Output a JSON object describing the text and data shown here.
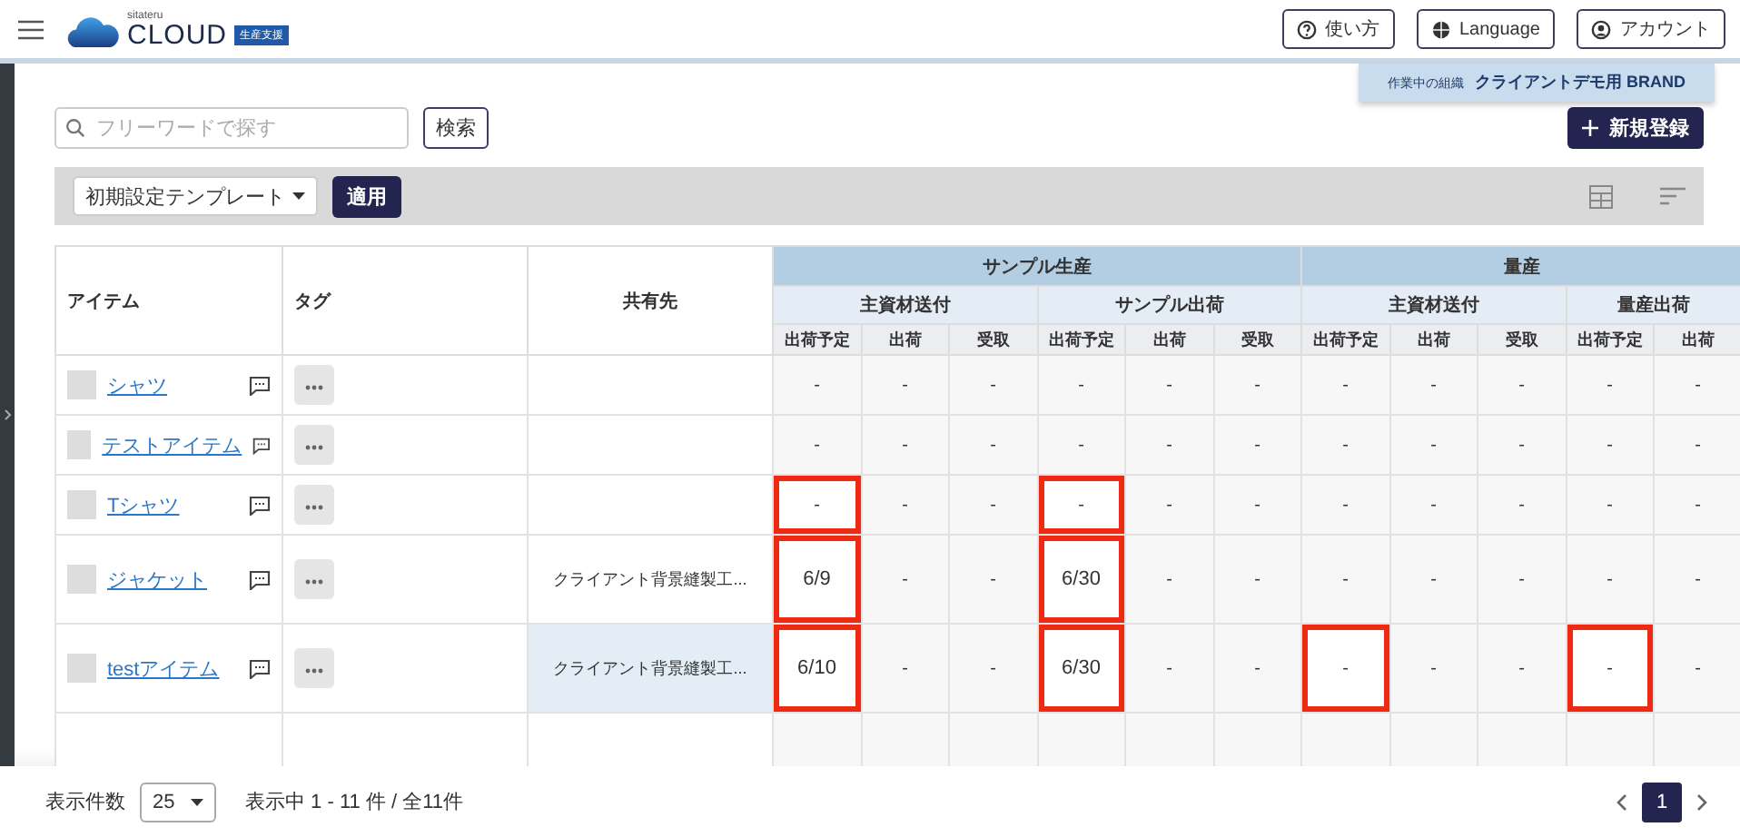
{
  "header": {
    "logo": {
      "tagline": "sitateru",
      "name": "CLOUD",
      "badge": "生産支援"
    },
    "buttons": [
      {
        "kind": "help",
        "label": "使い方"
      },
      {
        "kind": "globe",
        "label": "Language"
      },
      {
        "kind": "account",
        "label": "アカウント"
      }
    ]
  },
  "organization": {
    "label": "作業中の組織",
    "name": "クライアントデモ用 BRAND"
  },
  "search": {
    "placeholder": "フリーワードで探す",
    "button": "検索"
  },
  "new_button": "新規登録",
  "toolbar": {
    "template": "初期設定テンプレート",
    "apply": "適用"
  },
  "table": {
    "columns": [
      "アイテム",
      "タグ",
      "共有先"
    ],
    "groups": [
      {
        "label": "サンプル生産",
        "subgroups": [
          {
            "label": "主資材送付",
            "columns": [
              "出荷予定",
              "出荷",
              "受取"
            ]
          },
          {
            "label": "サンプル出荷",
            "columns": [
              "出荷予定",
              "出荷",
              "受取"
            ]
          }
        ]
      },
      {
        "label": "量産",
        "subgroups": [
          {
            "label": "主資材送付",
            "columns": [
              "出荷予定",
              "出荷",
              "受取"
            ]
          },
          {
            "label": "量産出荷",
            "columns": [
              "出荷予定",
              "出荷"
            ]
          }
        ]
      }
    ],
    "rows": [
      {
        "item": "シャツ",
        "shared": "",
        "hovered": false,
        "cells": [
          {
            "value": "-",
            "highlighted": false
          },
          {
            "value": "-",
            "highlighted": false
          },
          {
            "value": "-",
            "highlighted": false
          },
          {
            "value": "-",
            "highlighted": false
          },
          {
            "value": "-",
            "highlighted": false
          },
          {
            "value": "-",
            "highlighted": false
          },
          {
            "value": "-",
            "highlighted": false
          },
          {
            "value": "-",
            "highlighted": false
          },
          {
            "value": "-",
            "highlighted": false
          },
          {
            "value": "-",
            "highlighted": false
          },
          {
            "value": "-",
            "highlighted": false
          }
        ]
      },
      {
        "item": "テストアイテム",
        "shared": "",
        "hovered": false,
        "cells": [
          {
            "value": "-",
            "highlighted": false
          },
          {
            "value": "-",
            "highlighted": false
          },
          {
            "value": "-",
            "highlighted": false
          },
          {
            "value": "-",
            "highlighted": false
          },
          {
            "value": "-",
            "highlighted": false
          },
          {
            "value": "-",
            "highlighted": false
          },
          {
            "value": "-",
            "highlighted": false
          },
          {
            "value": "-",
            "highlighted": false
          },
          {
            "value": "-",
            "highlighted": false
          },
          {
            "value": "-",
            "highlighted": false
          },
          {
            "value": "-",
            "highlighted": false
          }
        ]
      },
      {
        "item": "Tシャツ",
        "shared": "",
        "hovered": false,
        "cells": [
          {
            "value": "-",
            "highlighted": true
          },
          {
            "value": "-",
            "highlighted": false
          },
          {
            "value": "-",
            "highlighted": false
          },
          {
            "value": "-",
            "highlighted": true
          },
          {
            "value": "-",
            "highlighted": false
          },
          {
            "value": "-",
            "highlighted": false
          },
          {
            "value": "-",
            "highlighted": false
          },
          {
            "value": "-",
            "highlighted": false
          },
          {
            "value": "-",
            "highlighted": false
          },
          {
            "value": "-",
            "highlighted": false
          },
          {
            "value": "-",
            "highlighted": false
          }
        ]
      },
      {
        "item": "ジャケット",
        "shared": "クライアント背景縫製工...",
        "hovered": false,
        "cells": [
          {
            "value": "6/9",
            "highlighted": true
          },
          {
            "value": "-",
            "highlighted": false
          },
          {
            "value": "-",
            "highlighted": false
          },
          {
            "value": "6/30",
            "highlighted": true
          },
          {
            "value": "-",
            "highlighted": false
          },
          {
            "value": "-",
            "highlighted": false
          },
          {
            "value": "-",
            "highlighted": false
          },
          {
            "value": "-",
            "highlighted": false
          },
          {
            "value": "-",
            "highlighted": false
          },
          {
            "value": "-",
            "highlighted": false
          },
          {
            "value": "-",
            "highlighted": false
          }
        ]
      },
      {
        "item": "testアイテム",
        "shared": "クライアント背景縫製工...",
        "hovered": true,
        "cells": [
          {
            "value": "6/10",
            "highlighted": true
          },
          {
            "value": "-",
            "highlighted": false
          },
          {
            "value": "-",
            "highlighted": false
          },
          {
            "value": "6/30",
            "highlighted": true
          },
          {
            "value": "-",
            "highlighted": false
          },
          {
            "value": "-",
            "highlighted": false
          },
          {
            "value": "-",
            "highlighted": true
          },
          {
            "value": "-",
            "highlighted": false
          },
          {
            "value": "-",
            "highlighted": false
          },
          {
            "value": "-",
            "highlighted": true
          },
          {
            "value": "-",
            "highlighted": false
          }
        ]
      }
    ]
  },
  "footer": {
    "page_size_label": "表示件数",
    "page_size": "25",
    "range": "表示中 1 - 11 件 / 全11件",
    "pages": [
      {
        "label": "1",
        "selected": true
      }
    ]
  }
}
